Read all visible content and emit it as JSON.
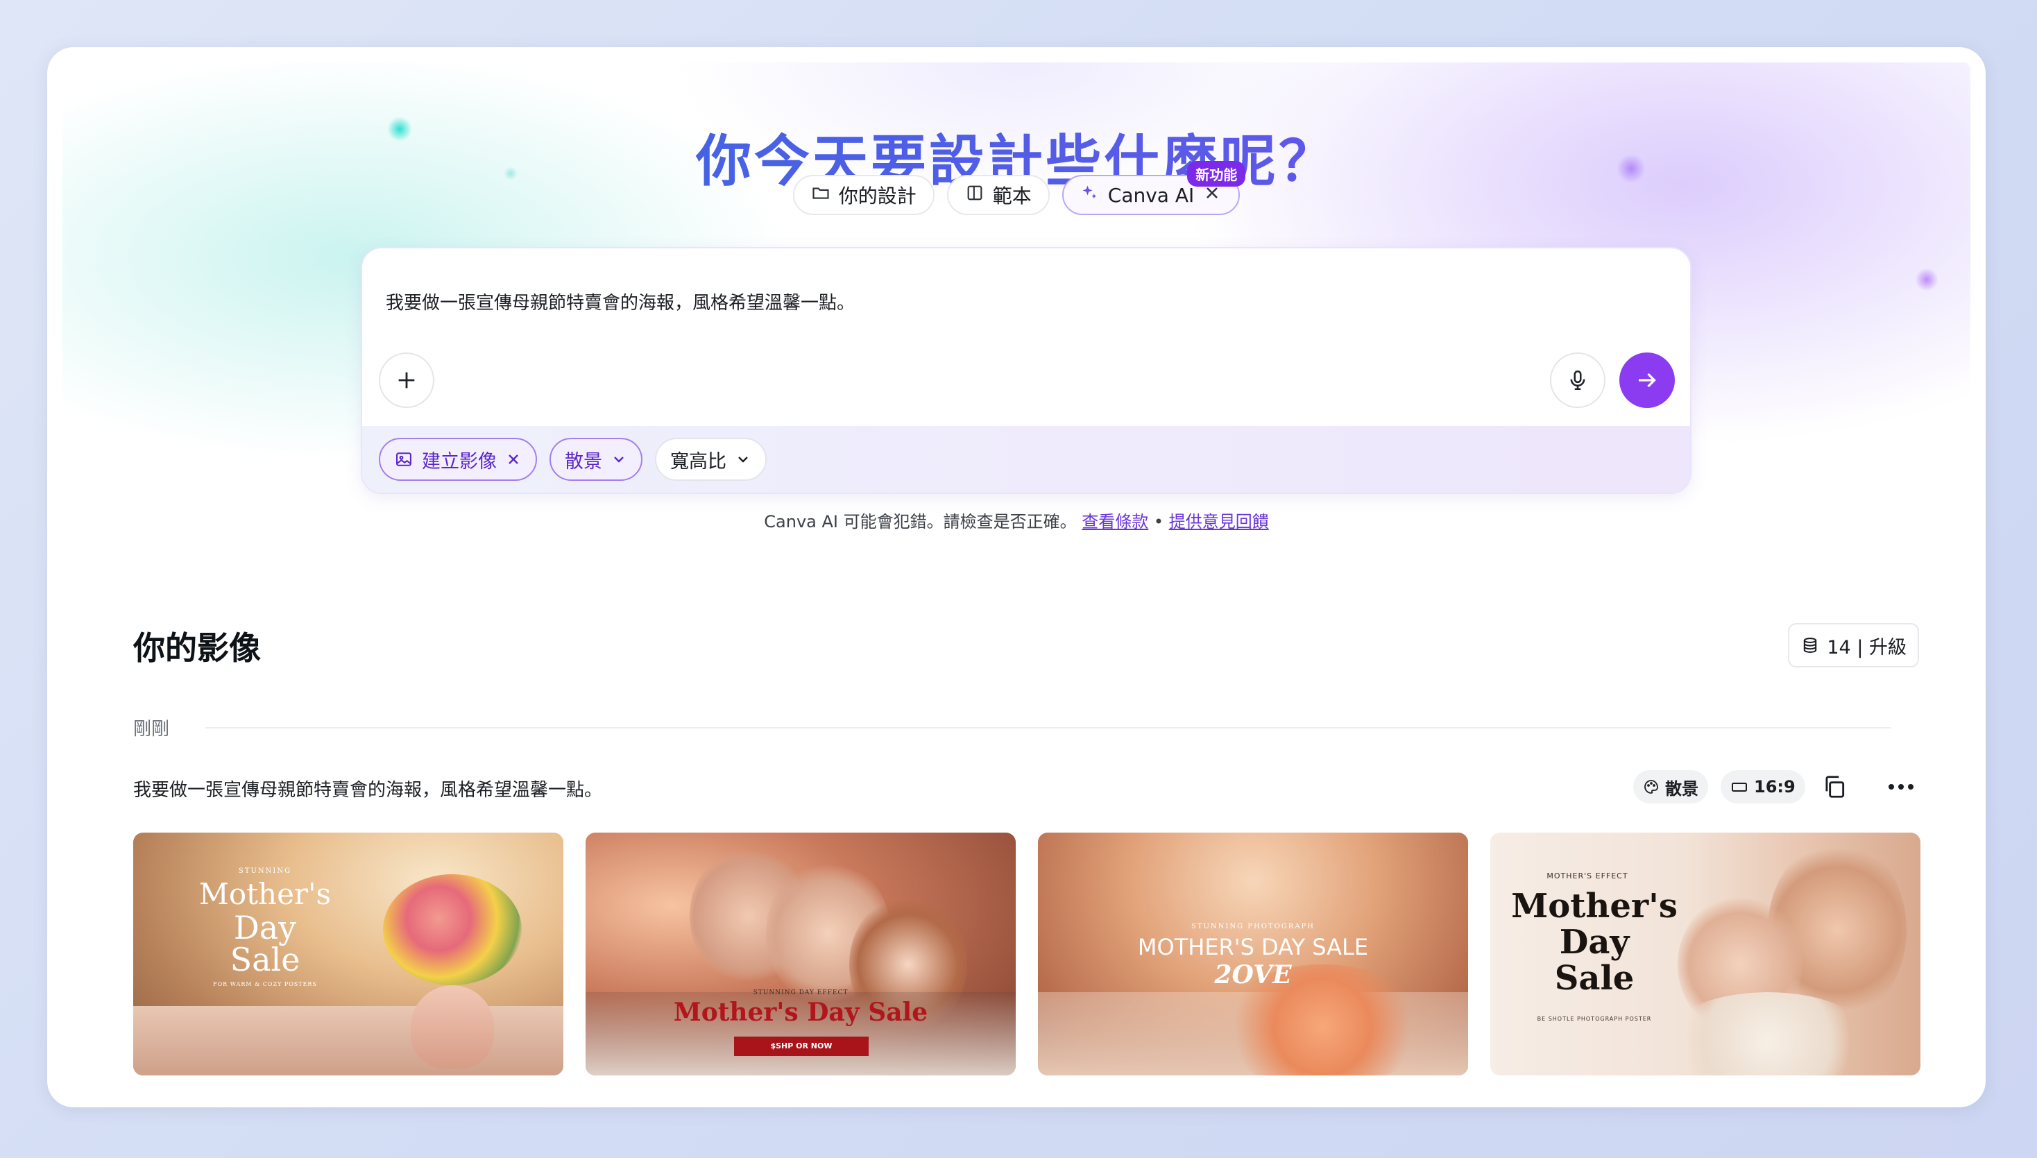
{
  "hero": {
    "headline": "你今天要設計些什麼呢？",
    "tabs": [
      {
        "label": "你的設計",
        "icon": "folder-icon"
      },
      {
        "label": "範本",
        "icon": "template-icon"
      },
      {
        "label": "Canva AI",
        "icon": "sparkle-icon",
        "badge": "新功能",
        "active": true
      }
    ]
  },
  "composer": {
    "prompt": "我要做一張宣傳母親節特賣會的海報，風格希望溫馨一點。",
    "chips": [
      {
        "label": "建立影像",
        "icon": "image-icon",
        "removable": true
      },
      {
        "label": "散景",
        "icon": "chevron-down-icon"
      },
      {
        "label": "寬高比",
        "icon": "chevron-down-icon"
      }
    ]
  },
  "disclaimer": {
    "text": "Canva AI 可能會犯錯。請檢查是否正確。",
    "terms_link": "查看條款",
    "separator": "•",
    "feedback_link": "提供意見回饋"
  },
  "images_section": {
    "title": "你的影像",
    "credits": "14 | 升級",
    "group_label": "剛剛",
    "prompt": "我要做一張宣傳母親節特賣會的海報，風格希望溫馨一點。",
    "style_tag": "散景",
    "ratio_tag": "16:9",
    "thumbnails": [
      {
        "small_top": "STUNNING",
        "title_lines": [
          "Mother's",
          "Day",
          "Sale"
        ],
        "small_bottom": "FOR WARM & COZY POSTERS"
      },
      {
        "small_top": "STUNNING DAY EFFECT",
        "title_lines": [
          "Mother's Day Sale"
        ],
        "button": "$SHP OR NOW"
      },
      {
        "small_top": "STUNNING PHOTOGRAPH",
        "title_lines": [
          "MOTHER'S DAY SALE"
        ],
        "script": "2OVE"
      },
      {
        "small_top": "MOTHER'S EFFECT",
        "title_lines": [
          "Mother's",
          "Day",
          "Sale"
        ],
        "small_bottom": "BE SHOTLE PHOTOGRAPH POSTER"
      }
    ]
  },
  "colors": {
    "accent": "#8b3cf0",
    "badge": "#7d2ae8",
    "link": "#6a36d8"
  }
}
